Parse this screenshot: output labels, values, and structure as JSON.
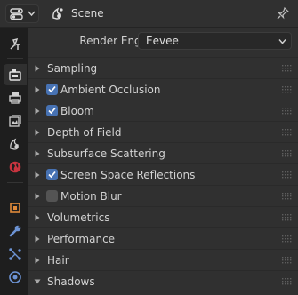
{
  "header": {
    "editor_type_icon": "properties-editor-icon",
    "context_icon": "scene-icon",
    "title": "Scene",
    "pin_icon": "pin-icon"
  },
  "tabs": [
    {
      "name": "tool",
      "icon": "tool-settings-icon",
      "active": false
    },
    {
      "name": "render",
      "icon": "render-camera-icon",
      "active": true
    },
    {
      "name": "output",
      "icon": "printer-output-icon",
      "active": false
    },
    {
      "name": "view-layer",
      "icon": "image-layers-icon",
      "active": false
    },
    {
      "name": "scene",
      "icon": "scene-icon",
      "active": false
    },
    {
      "name": "world",
      "icon": "world-globe-icon",
      "active": false
    },
    {
      "name": "object",
      "icon": "object-square-icon",
      "active": false
    },
    {
      "name": "modifiers",
      "icon": "wrench-icon",
      "active": false
    },
    {
      "name": "particles",
      "icon": "particles-icon",
      "active": false
    },
    {
      "name": "physics",
      "icon": "physics-circle-icon",
      "active": false
    }
  ],
  "render_engine": {
    "label": "Render Engine",
    "value": "Eevee"
  },
  "panels": [
    {
      "label": "Sampling",
      "has_checkbox": false,
      "checked": false,
      "expanded": false
    },
    {
      "label": "Ambient Occlusion",
      "has_checkbox": true,
      "checked": true,
      "expanded": false
    },
    {
      "label": "Bloom",
      "has_checkbox": true,
      "checked": true,
      "expanded": false
    },
    {
      "label": "Depth of Field",
      "has_checkbox": false,
      "checked": false,
      "expanded": false
    },
    {
      "label": "Subsurface Scattering",
      "has_checkbox": false,
      "checked": false,
      "expanded": false
    },
    {
      "label": "Screen Space Reflections",
      "has_checkbox": true,
      "checked": true,
      "expanded": false
    },
    {
      "label": "Motion Blur",
      "has_checkbox": true,
      "checked": false,
      "expanded": false
    },
    {
      "label": "Volumetrics",
      "has_checkbox": false,
      "checked": false,
      "expanded": false
    },
    {
      "label": "Performance",
      "has_checkbox": false,
      "checked": false,
      "expanded": false
    },
    {
      "label": "Hair",
      "has_checkbox": false,
      "checked": false,
      "expanded": false
    },
    {
      "label": "Shadows",
      "has_checkbox": false,
      "checked": false,
      "expanded": true
    }
  ],
  "colors": {
    "accent": "#4772b3",
    "panel_bg": "#303030",
    "window_bg": "#1d1d1d"
  }
}
